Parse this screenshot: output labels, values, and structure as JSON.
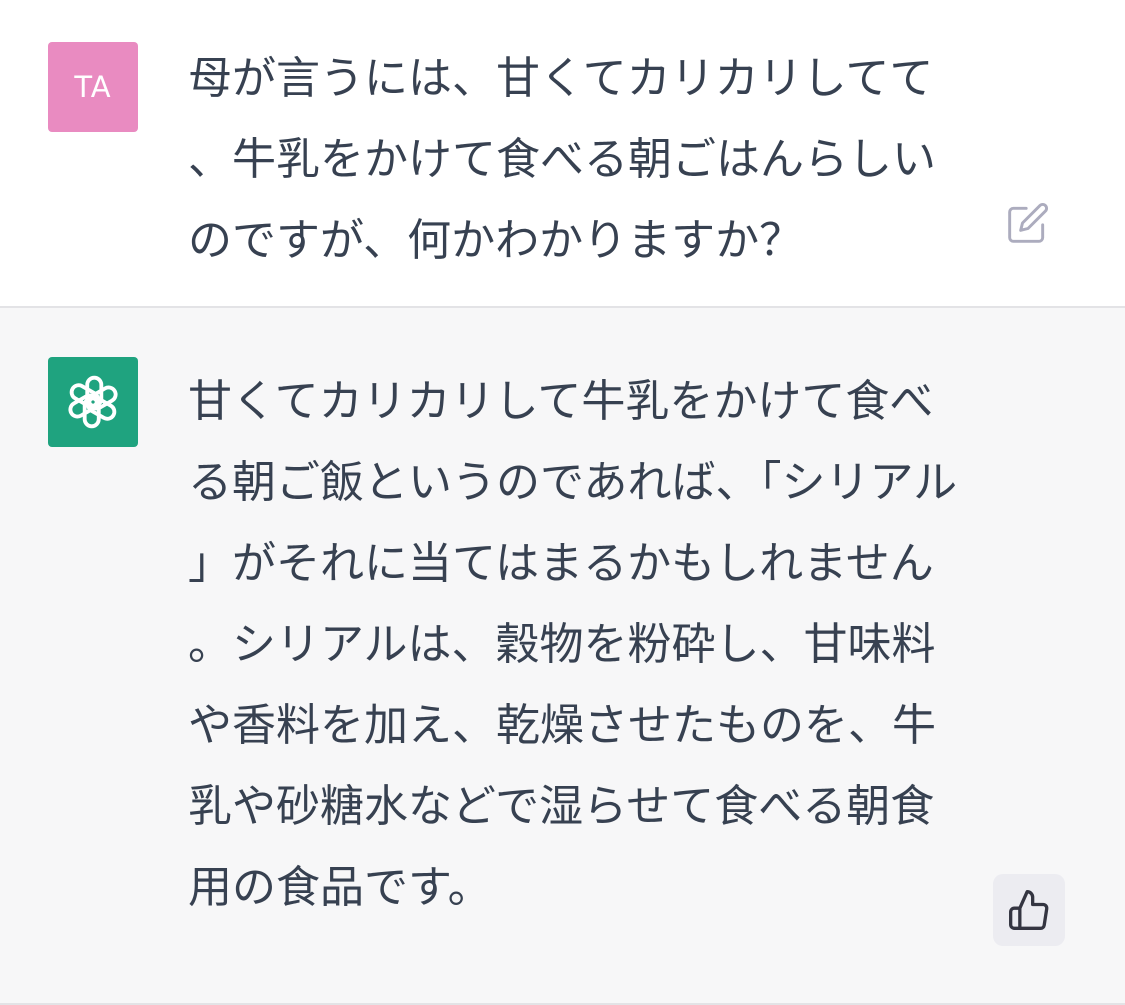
{
  "conversation": {
    "user_message": {
      "avatar_initials": "TA",
      "avatar_color": "#e98bc1",
      "text": "母が言うには、甘くてカリカリしてて、牛乳をかけて食べる朝ごはんらしいのですが、何かわかりますか？",
      "edit_icon": "edit-icon"
    },
    "assistant_message": {
      "avatar_icon": "openai-logo-icon",
      "avatar_color": "#1fa37f",
      "text": "甘くてカリカリして牛乳をかけて食べる朝ご飯というのであれば、「シリアル」がそれに当てはまるかもしれません。シリアルは、穀物を粉砕し、甘味料や香料を加え、乾燥させたものを、牛乳や砂糖水などで湿らせて食べる朝食用の食品です。",
      "feedback_icon": "thumbs-up-icon"
    }
  }
}
